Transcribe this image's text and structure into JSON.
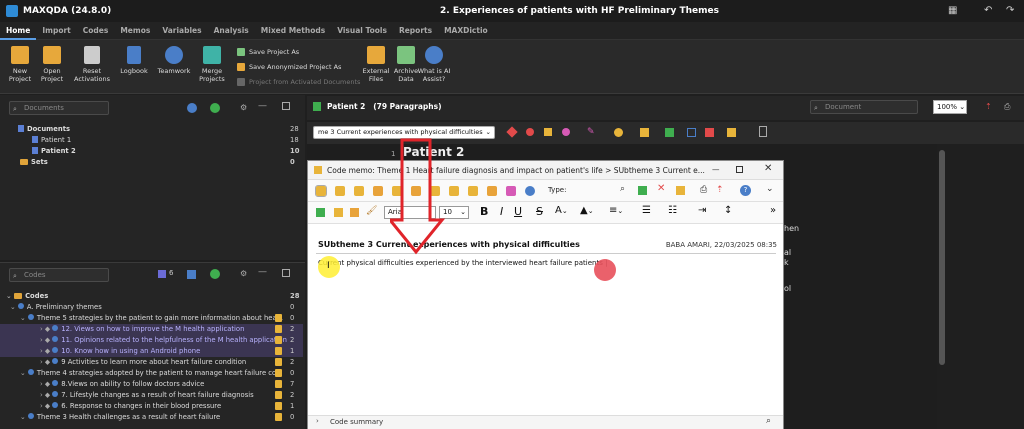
{
  "app": {
    "title": "MAXQDA (24.8.0)",
    "document_title": "2. Experiences of patients with HF Preliminary Themes"
  },
  "menu": [
    "Home",
    "Import",
    "Codes",
    "Memos",
    "Variables",
    "Analysis",
    "Mixed Methods",
    "Visual Tools",
    "Reports",
    "MAXDictio"
  ],
  "ribbon": {
    "new_project": "New\nProject",
    "open_project": "Open\nProject",
    "reset": "Reset\nActivations",
    "logbook": "Logbook",
    "teamwork": "Teamwork",
    "merge": "Merge\nProjects",
    "save_as": "Save Project As",
    "save_anon": "Save Anonymized Project As",
    "from_activated": "Project from Activated Documents",
    "external": "External\nFiles",
    "archive": "Archive\nData",
    "ai": "What is AI\nAssist?"
  },
  "documents": {
    "search_placeholder": "Documents",
    "root": "Documents",
    "root_count": "28",
    "items": [
      {
        "label": "Patient 1",
        "count": "18"
      },
      {
        "label": "Patient 2",
        "count": "10"
      }
    ],
    "sets": "Sets",
    "sets_count": "0"
  },
  "codes": {
    "search_placeholder": "Codes",
    "count_a": "6",
    "root": "Codes",
    "root_count": "28",
    "rows": [
      {
        "label": "A. Preliminary themes",
        "count": "0",
        "indent": 10,
        "memo": false,
        "sel": false
      },
      {
        "label": "Theme 5 strategies by the patient to gain more information about hea...",
        "count": "0",
        "indent": 20,
        "memo": true,
        "sel": false
      },
      {
        "label": "12. Views on how to improve the M health application",
        "count": "2",
        "indent": 40,
        "memo": true,
        "sel": true
      },
      {
        "label": "11. Opinions related to the helpfulness of the M health application",
        "count": "2",
        "indent": 40,
        "memo": true,
        "sel": true
      },
      {
        "label": "10. Know how in using an Android phone",
        "count": "1",
        "indent": 40,
        "memo": true,
        "sel": true
      },
      {
        "label": "9 Activities to learn more about heart failure condition",
        "count": "2",
        "indent": 40,
        "memo": true,
        "sel": false
      },
      {
        "label": "Theme 4 strategies adopted by the patient to manage heart failure co...",
        "count": "0",
        "indent": 20,
        "memo": true,
        "sel": false
      },
      {
        "label": "8.Views on ability to follow doctors advice",
        "count": "7",
        "indent": 40,
        "memo": true,
        "sel": false
      },
      {
        "label": "7. Lifestyle changes as a result of heart failure diagnosis",
        "count": "2",
        "indent": 40,
        "memo": true,
        "sel": false
      },
      {
        "label": "6. Response to changes in their blood pressure",
        "count": "1",
        "indent": 40,
        "memo": true,
        "sel": false
      },
      {
        "label": "Theme 3 Health challenges as a result of heart failure",
        "count": "0",
        "indent": 20,
        "memo": true,
        "sel": false
      }
    ]
  },
  "viewer": {
    "tab_label": "Patient 2",
    "paragraphs": "(79 Paragraphs)",
    "code_dropdown": "me 3 Current experiences with physical difficulties",
    "search_placeholder": "Document",
    "zoom": "100%",
    "heading": "Patient 2",
    "line_number": "1",
    "side_fragments": [
      "hen",
      "al",
      "k",
      "ol"
    ]
  },
  "dialog": {
    "title": "Code memo: Theme 1 Heart failure diagnosis and impact on patient's life > SUbtheme 3 Current e...",
    "type_label": "Type:",
    "font": "Arial",
    "font_size": "10",
    "memo_title": "SUbtheme 3 Current experiences with physical difficulties",
    "meta": "BABA AMARI, 22/03/2025 08:35",
    "memo_text": "Current physical difficulties experienced by the interviewed heart failure patients",
    "footer": "Code summary"
  },
  "colors": {
    "accent": "#5a9ee6",
    "arrow": "#e0242a",
    "cursor_dot": "#e8505b",
    "highlight": "#ffee33"
  }
}
